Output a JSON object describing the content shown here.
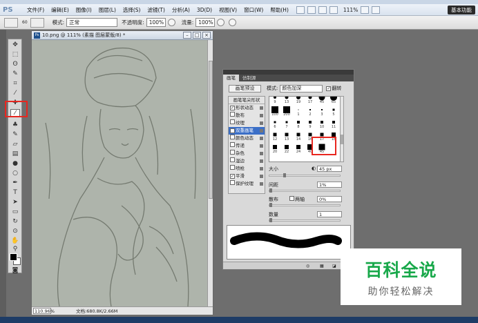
{
  "app": {
    "logo_text": "PS",
    "workspace_button": "基本功能"
  },
  "menu": [
    "文件(F)",
    "编辑(E)",
    "图像(I)",
    "图层(L)",
    "选择(S)",
    "滤镜(T)",
    "分析(A)",
    "3D(D)",
    "视图(V)",
    "窗口(W)",
    "帮助(H)"
  ],
  "menubar_zoom": "111%",
  "options_bar": {
    "brush_size": "60",
    "mode_label": "模式:",
    "mode_value": "正常",
    "opacity_label": "不透明度:",
    "opacity_value": "100%",
    "flow_label": "流量:",
    "flow_value": "100%"
  },
  "document": {
    "title": "10.png @ 111% (素描  图层蒙版/8) *",
    "zoom": "110.96%",
    "doc_info": "文档:680.8K/2.66M"
  },
  "brush_panel": {
    "tabs": [
      "画笔",
      "仿制源"
    ],
    "preset_button": "画笔预设",
    "mode_label": "模式:",
    "mode_value": "颜色加深",
    "flip_label": "翻转",
    "options_header": "画笔笔尖形状",
    "options": [
      {
        "label": "形状动态",
        "checked": true
      },
      {
        "label": "散布",
        "checked": false
      },
      {
        "label": "纹理",
        "checked": false
      },
      {
        "label": "双重画笔",
        "checked": true
      },
      {
        "label": "颜色动态",
        "checked": false
      },
      {
        "label": "传递",
        "checked": false
      },
      {
        "label": "杂色",
        "checked": false
      },
      {
        "label": "湿边",
        "checked": false
      },
      {
        "label": "喷枪",
        "checked": false
      },
      {
        "label": "平滑",
        "checked": true
      },
      {
        "label": "保护纹理",
        "checked": false
      }
    ],
    "brush_sizes": [
      "9",
      "13",
      "19",
      "17",
      "45",
      "65",
      "100",
      "200",
      "1",
      "2",
      "3",
      "5",
      "6",
      "7",
      "8",
      "9",
      "10",
      "11",
      "12",
      "13",
      "14",
      "16",
      "17",
      "18",
      "20",
      "22",
      "24",
      "40",
      "45"
    ],
    "size_label": "大小",
    "size_value": "45 px",
    "spacing_label": "间距",
    "spacing_value": "1%",
    "scatter_label": "散布",
    "both_axes_label": "两轴",
    "scatter_value": "0%",
    "count_label": "数量",
    "count_value": "1"
  },
  "watermark": {
    "title": "百科全说",
    "subtitle": "助你轻松解决"
  },
  "colors": {
    "highlight": "#e8261f",
    "watermark_green": "#18a84a"
  }
}
